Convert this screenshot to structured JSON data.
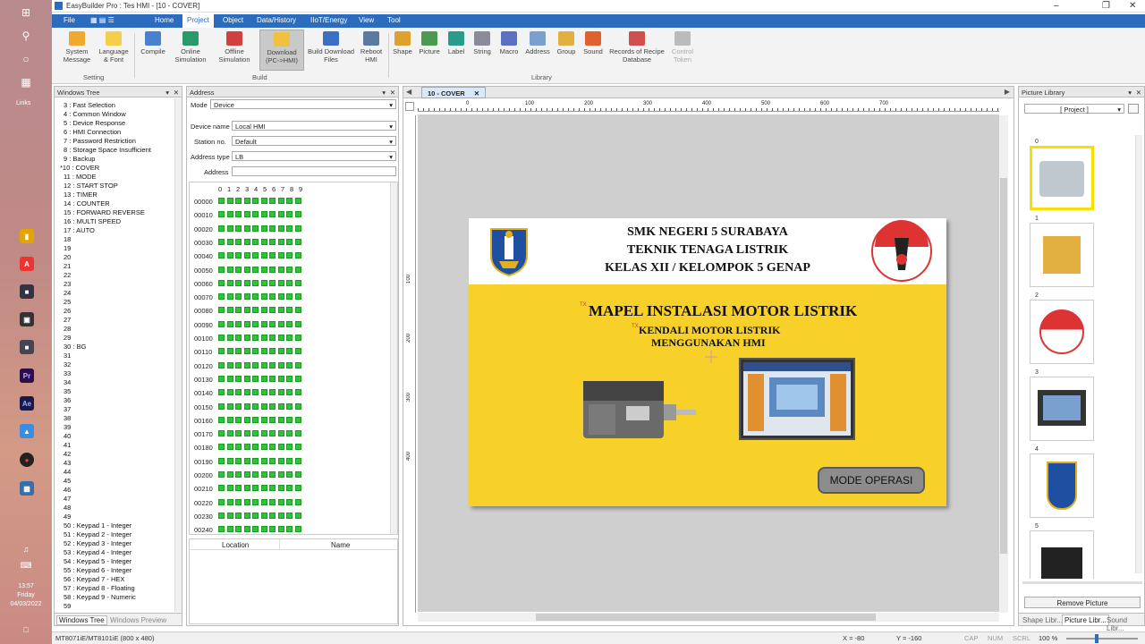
{
  "window": {
    "title": "EasyBuilder Pro : Tes HMI - [10 - COVER]"
  },
  "menu": [
    "File",
    "Home",
    "Project",
    "Object",
    "Data/History",
    "IIoT/Energy",
    "View",
    "Tool"
  ],
  "ribbon": {
    "buttons": [
      "System Message",
      "Language & Font",
      "Compile",
      "Online Simulation",
      "Offline Simulation",
      "Download (PC->HMI)",
      "Build Download Files",
      "Reboot HMI",
      "Shape",
      "Picture",
      "Label",
      "String",
      "Macro",
      "Address",
      "Group",
      "Sound",
      "Records of Recipe Database",
      "Control Token"
    ],
    "groups": [
      "Setting",
      "Build",
      "Library"
    ]
  },
  "taskbar": {
    "links": "Links",
    "time": "13:57",
    "day": "Friday",
    "date": "04/03/2022"
  },
  "windows_tree": {
    "title": "Windows Tree",
    "items": [
      "3 : Fast Selection",
      "4 : Common Window",
      "5 : Device Response",
      "6 : HMI Connection",
      "7 : Password Restriction",
      "8 : Storage Space Insufficient",
      "9 : Backup",
      "*10 : COVER",
      "11 : MODE",
      "12 : START STOP",
      "13 : TIMER",
      "14 : COUNTER",
      "15 : FORWARD REVERSE",
      "16 : MULTI SPEED",
      "17 : AUTO",
      "18",
      "19",
      "20",
      "21",
      "22",
      "23",
      "24",
      "25",
      "26",
      "27",
      "28",
      "29",
      "30 : BG",
      "31",
      "32",
      "33",
      "34",
      "35",
      "36",
      "37",
      "38",
      "39",
      "40",
      "41",
      "42",
      "43",
      "44",
      "45",
      "46",
      "47",
      "48",
      "49",
      "50 : Keypad 1 - Integer",
      "51 : Keypad 2 - Integer",
      "52 : Keypad 3 - Integer",
      "53 : Keypad 4 - Integer",
      "54 : Keypad 5 - Integer",
      "55 : Keypad 6 - Integer",
      "56 : Keypad 7 - HEX",
      "57 : Keypad 8 - Floating",
      "58 : Keypad 9 - Numeric",
      "59"
    ],
    "tab1": "Windows Tree",
    "tab2": "Windows Preview"
  },
  "address": {
    "title": "Address",
    "mode_label": "Mode",
    "mode_value": "Device",
    "device_label": "Device name",
    "device_value": "Local HMI",
    "station_label": "Station no.",
    "station_value": "Default",
    "type_label": "Address type",
    "type_value": "LB",
    "addr_label": "Address",
    "bit_header": [
      "0",
      "1",
      "2",
      "3",
      "4",
      "5",
      "6",
      "7",
      "8",
      "9"
    ],
    "rows": [
      "00000",
      "00010",
      "00020",
      "00030",
      "00040",
      "00050",
      "00060",
      "00070",
      "00080",
      "00090",
      "00100",
      "00110",
      "00120",
      "00130",
      "00140",
      "00150",
      "00160",
      "00170",
      "00180",
      "00190",
      "00200",
      "00210",
      "00220",
      "00230",
      "00240"
    ],
    "col_location": "Location",
    "col_name": "Name"
  },
  "editor": {
    "tab": "10 - COVER",
    "ruler": [
      "0",
      "100",
      "200",
      "300",
      "400",
      "500",
      "600",
      "700"
    ],
    "vruler": [
      "100",
      "200",
      "300",
      "400"
    ],
    "line1": "SMK NEGERI 5 SURABAYA",
    "line2": "TEKNIK TENAGA LISTRIK",
    "line3": "KELAS XII / KELOMPOK 5 GENAP",
    "title": "MAPEL INSTALASI MOTOR LISTRIK",
    "sub1": "KENDALI MOTOR LISTRIK",
    "sub2": "MENGGUNAKAN HMI",
    "tx": "TX",
    "button": "MODE OPERASI"
  },
  "picture_library": {
    "title": "Picture Library",
    "dropdown": "[ Project ]",
    "thumbs": [
      "0",
      "1",
      "2",
      "3",
      "4",
      "5"
    ],
    "remove": "Remove Picture",
    "tabs": [
      "Shape Libr...",
      "Picture Libr...",
      "Sound Libr..."
    ]
  },
  "status": {
    "model": "MT8071iE/MT8101iE (800 x 480)",
    "x": "X = -80",
    "y": "Y = -160",
    "cap": "CAP",
    "num": "NUM",
    "scrl": "SCRL",
    "zoom": "100 %"
  }
}
